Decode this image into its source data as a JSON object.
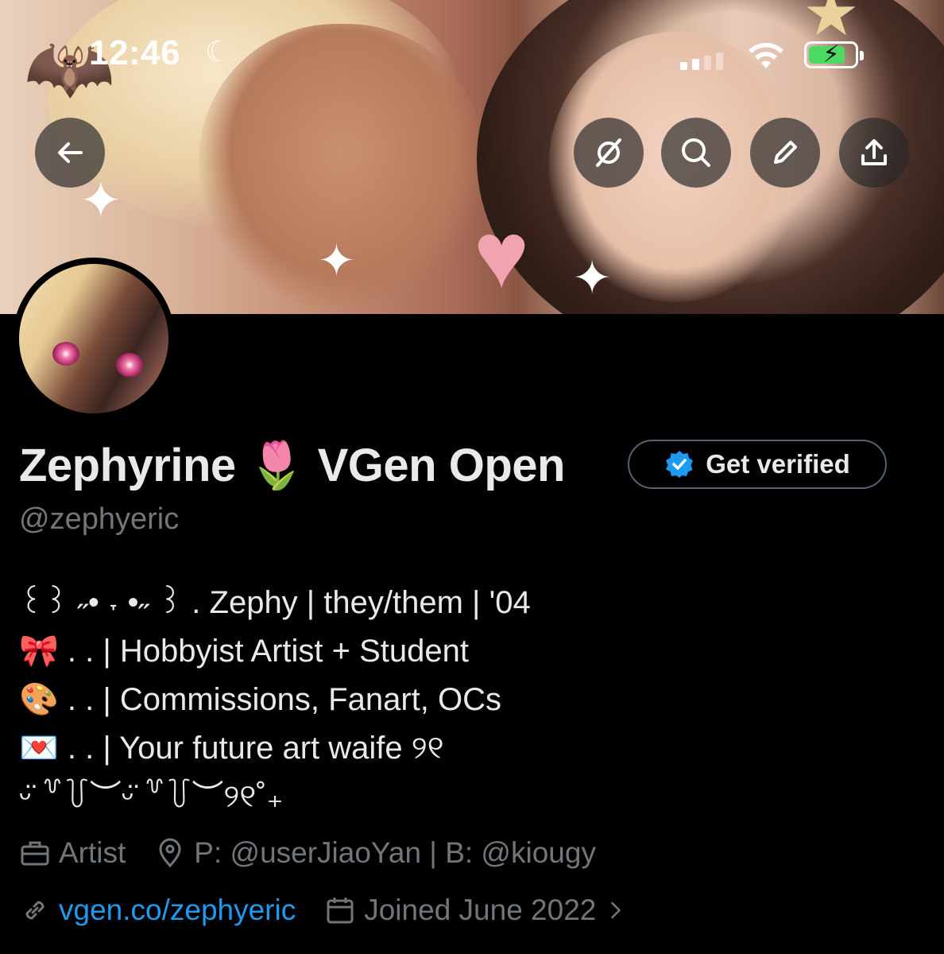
{
  "status_bar": {
    "time": "12:46"
  },
  "nav": {
    "back": "back-arrow-icon",
    "actions": [
      "grok-icon",
      "search-icon",
      "edit-icon",
      "share-icon"
    ]
  },
  "profile": {
    "display_name": "Zephyrine 🌷 VGen Open",
    "get_verified_label": "Get verified",
    "handle": "@zephyeric",
    "bio_lines": [
      "꒰꒱ ˶• ˕ •˶ ꒱ . Zephy | they/them | '04",
      "🎀 . . | Hobbyist Artist + Student",
      "🎨 . . | Commissions, Fanart, OCs",
      "💌 . . | Your future art waife ୨୧",
      "ᵕ̈ ꒷꒦︶ᵕ̈ ꒷꒦︶୨୧˚₊"
    ],
    "category": "Artist",
    "location": "P: @userJiaoYan | B: @kiougy",
    "website": "vgen.co/zephyeric",
    "joined": "Joined June 2022"
  },
  "colors": {
    "background": "#000000",
    "primary_text": "#e7e9ea",
    "secondary_text": "#71767b",
    "link": "#1d9bf0",
    "verified_badge": "#1d9bf0"
  }
}
